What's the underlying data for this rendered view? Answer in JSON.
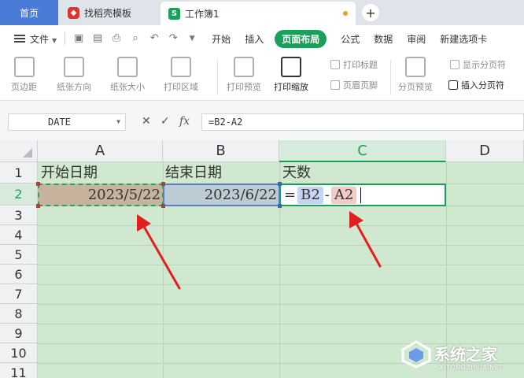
{
  "tabs": {
    "home": "首页",
    "template": "找稻壳模板",
    "workbook": "工作簿1"
  },
  "menu": {
    "file": "文件",
    "items": [
      "开始",
      "插入",
      "页面布局",
      "公式",
      "数据",
      "审阅",
      "新建选项卡"
    ],
    "active_index": 2
  },
  "ribbon": {
    "margins": "页边距",
    "orientation": "纸张方向",
    "size": "纸张大小",
    "print_area": "打印区域",
    "print_preview": "打印预览",
    "print_scale": "打印缩放",
    "print_titles": "打印标题",
    "header_footer": "页眉页脚",
    "page_break_preview": "分页预览",
    "show_page_breaks": "显示分页符",
    "insert_page_break": "插入分页符"
  },
  "formula_bar": {
    "name_box": "DATE",
    "cancel": "✕",
    "confirm": "✓",
    "fx": "fx",
    "formula": "=B2-A2"
  },
  "sheet": {
    "columns": [
      "A",
      "B",
      "C",
      "D"
    ],
    "rows": [
      "1",
      "2",
      "3",
      "4",
      "5",
      "6",
      "7",
      "8",
      "9",
      "10",
      "11"
    ],
    "cells": {
      "A1": "开始日期",
      "B1": "结束日期",
      "C1": "天数",
      "A2": "2023/5/22",
      "B2": "2023/6/22",
      "C2_eq": "=",
      "C2_ref1": "B2",
      "C2_op": "-",
      "C2_ref2": "A2"
    }
  },
  "colors": {
    "accent": "#1aa05a",
    "grid_bg": "#cfe8cf",
    "arrow": "#e02020"
  },
  "watermark": {
    "title": "系统之家",
    "url": "XITONGZHIJIA.NET"
  }
}
